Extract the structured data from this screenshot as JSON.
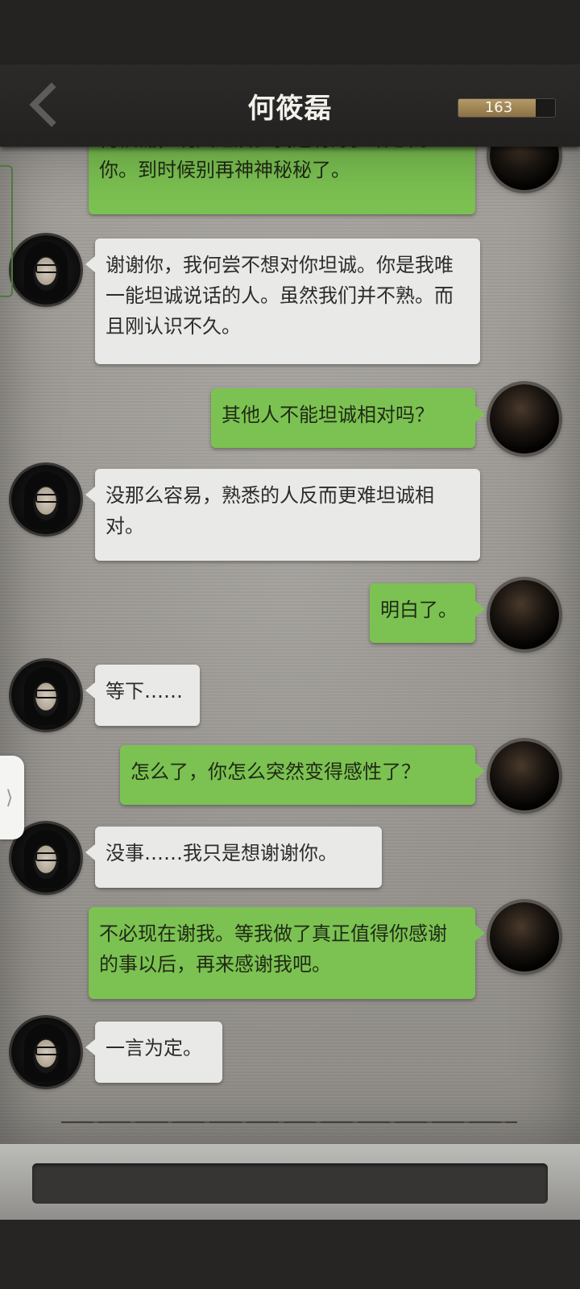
{
  "header": {
    "title": "何筱磊",
    "counter_value": "163",
    "counter_fill_fraction": 0.8
  },
  "messages": [
    {
      "side": "right",
      "text": "何筱磊，明天之后。我还有好多话想问你。到时候别再神神秘秘了。"
    },
    {
      "side": "left",
      "text": "谢谢你，我何尝不想对你坦诚。你是我唯一能坦诚说话的人。虽然我们并不熟。而且刚认识不久。"
    },
    {
      "side": "right",
      "text": "其他人不能坦诚相对吗？"
    },
    {
      "side": "left",
      "text": "没那么容易，熟悉的人反而更难坦诚相对。"
    },
    {
      "side": "right",
      "text": "明白了。"
    },
    {
      "side": "left",
      "text": "等下……"
    },
    {
      "side": "right",
      "text": "怎么了，你怎么突然变得感性了？"
    },
    {
      "side": "left",
      "text": "没事……我只是想谢谢你。"
    },
    {
      "side": "right",
      "text": "不必现在谢我。等我做了真正值得你感谢的事以后，再来感谢我吧。"
    },
    {
      "side": "left",
      "text": "一言为定。"
    }
  ],
  "side_tab": {
    "glyph": "⟩"
  },
  "colors": {
    "player_bubble": "#7cc252",
    "npc_bubble": "#e9e9e7",
    "header_bg": "#2b2a29",
    "counter_fill": "#b59a66"
  }
}
